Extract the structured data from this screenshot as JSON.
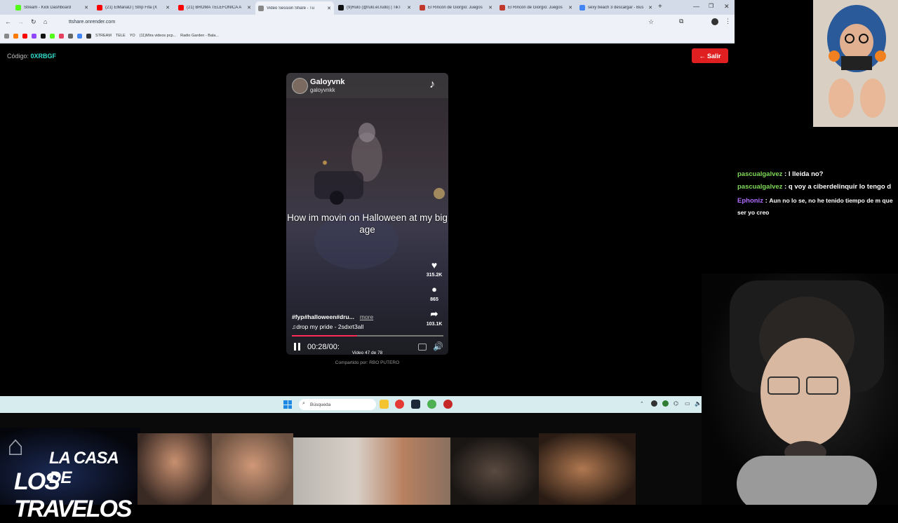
{
  "browser": {
    "tabs": [
      {
        "label": "Stream - Kick Dashboard",
        "color": "#53fc18"
      },
      {
        "label": "(21) ElMañaO | Strip Fifa (X",
        "color": "#ff0000"
      },
      {
        "label": "(21) BROMA TELEFÓNICA A",
        "color": "#ff0000"
      },
      {
        "label": "Video Session Share - Tu",
        "color": "#888888",
        "active": true
      },
      {
        "label": "(9)Rulo (@rulo.el.rudo) | TikT",
        "color": "#111111"
      },
      {
        "label": "El Rincón de Giorgio: Juegos",
        "color": "#c0392b"
      },
      {
        "label": "El Rincón de Giorgio: Juegos",
        "color": "#c0392b"
      },
      {
        "label": "sexy beach 3 descargar - Bus",
        "color": "#4285f4"
      }
    ],
    "url": "ttshare.onrender.com",
    "bookmarks": [
      "STREAM",
      "TELE",
      "YO",
      "(11)Mira videos pcp...",
      "Radio Garden - Bala..."
    ]
  },
  "page": {
    "code_label": "Código:",
    "code_value": "0XRBGF",
    "exit_button": "← Salir"
  },
  "video": {
    "author_name": "Galoyvnk",
    "author_handle": "galoyvnkk",
    "caption": "How im movin on Halloween at my big age",
    "likes": "315.2K",
    "comments": "865",
    "shares": "103.1K",
    "hashtags": "#fyp#halloween#dru...",
    "more_label": "more",
    "song": "♫drop my pride - 2sdxrt3all",
    "progress": 0.43,
    "time": "00:28/00:",
    "counter": "Video 47 de 78",
    "shared_by": "Compartido por: RBO PUTERO"
  },
  "chat": [
    {
      "user": "pascualgalvez",
      "text": "l lleida no?",
      "color": "#7ed957"
    },
    {
      "user": "pascualgalvez",
      "text": "q voy a ciberdelinquir lo tengo d",
      "color": "#7ed957"
    },
    {
      "user": "Ephoniz",
      "text": "Aun no lo se, no he tenido tiempo de m que ser yo creo",
      "color": "#b06cff"
    }
  ],
  "taskbar": {
    "search_placeholder": "Búsqueda"
  },
  "overlay": {
    "logo_line1": "LA CASA DE",
    "logo_line2": "LOS TRAVELOS"
  }
}
